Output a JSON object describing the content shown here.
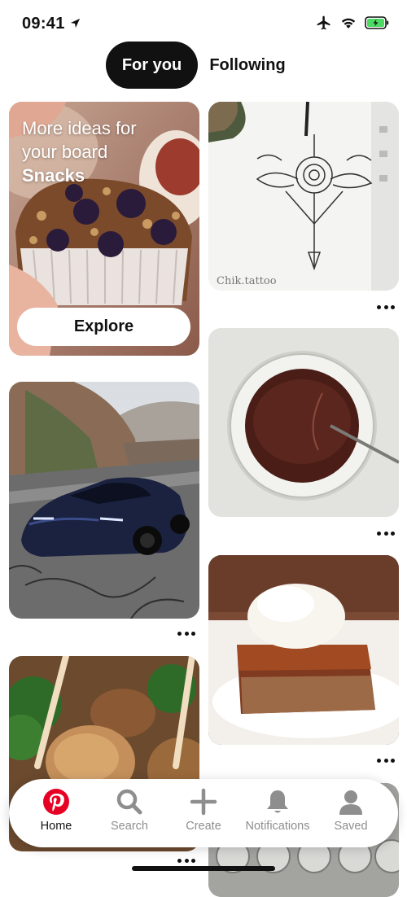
{
  "status_bar": {
    "time": "09:41"
  },
  "tabs": [
    {
      "label": "For you",
      "active": true
    },
    {
      "label": "Following",
      "active": false
    }
  ],
  "board_promo": {
    "line1": "More ideas for",
    "line2": "your board",
    "board_name": "Snacks",
    "explore_label": "Explore"
  },
  "pins": {
    "tattoo_watermark": "Chik.tattoo"
  },
  "nav": {
    "items": [
      {
        "label": "Home",
        "active": true
      },
      {
        "label": "Search"
      },
      {
        "label": "Create"
      },
      {
        "label": "Notifications"
      },
      {
        "label": "Saved"
      }
    ]
  },
  "colors": {
    "brand_red": "#e60023",
    "battery_green": "#4cd964",
    "inactive_gray": "#8e8e8e"
  }
}
